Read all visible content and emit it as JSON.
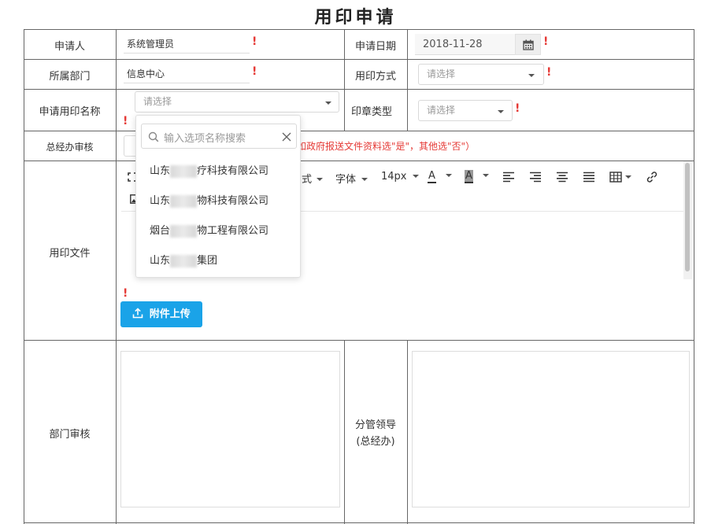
{
  "page_title": "用印申请",
  "rows": {
    "applicant": {
      "label": "申请人",
      "value": "系统管理员"
    },
    "apply_date": {
      "label": "申请日期",
      "value": "2018-11-28"
    },
    "department": {
      "label": "所属部门",
      "value": "信息中心"
    },
    "seal_method": {
      "label": "用印方式",
      "placeholder": "请选择"
    },
    "seal_name": {
      "label": "申请用印名称",
      "placeholder": "请选择"
    },
    "seal_type": {
      "label": "印章类型",
      "placeholder": "请选择"
    },
    "gm_review": {
      "label": "总经办审核",
      "notice": "如政府报送文件资料选\"是\"，其他选\"否\"）"
    },
    "seal_file": {
      "label": "用印文件",
      "upload_label": "附件上传"
    },
    "dept_review": {
      "label": "部门审核"
    },
    "branch_leader": {
      "label_line1": "分管领导",
      "label_line2": "(总经办)"
    }
  },
  "required_mark": "!",
  "toolbar": {
    "style_label": "式",
    "font_label": "字体",
    "size_label": "14px",
    "font_color_label": "A",
    "bg_color_label": "A"
  },
  "dropdown": {
    "search_placeholder": "输入选项名称搜索",
    "options": [
      {
        "prefix": "山东",
        "suffix": "疗科技有限公司"
      },
      {
        "prefix": "山东",
        "suffix": "物科技有限公司"
      },
      {
        "prefix": "烟台",
        "suffix": "物工程有限公司"
      },
      {
        "prefix": "山东",
        "suffix": "集团"
      }
    ]
  },
  "colors": {
    "required": "#e53935",
    "upload_button": "#1aa3e8",
    "border": "#666666"
  }
}
